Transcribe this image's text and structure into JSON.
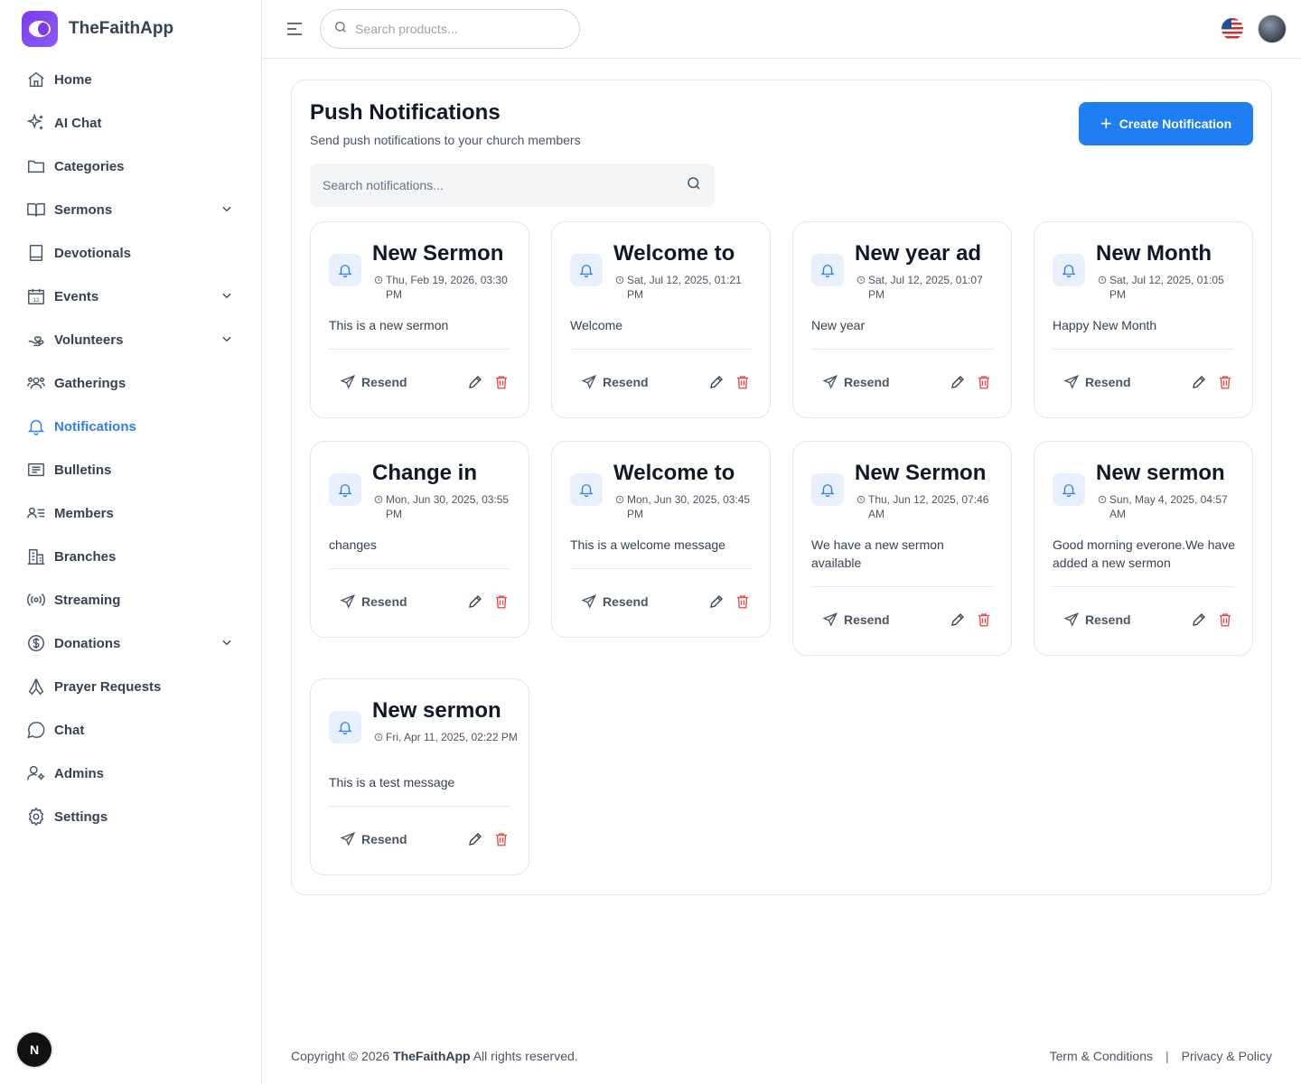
{
  "app": {
    "name": "TheFaithApp"
  },
  "sidebar": {
    "items": [
      {
        "label": "Home",
        "icon": "home-icon"
      },
      {
        "label": "AI Chat",
        "icon": "sparkles-icon"
      },
      {
        "label": "Categories",
        "icon": "folder-icon"
      },
      {
        "label": "Sermons",
        "icon": "book-open-icon",
        "expandable": true
      },
      {
        "label": "Devotionals",
        "icon": "book-icon"
      },
      {
        "label": "Events",
        "icon": "calendar-icon",
        "expandable": true
      },
      {
        "label": "Volunteers",
        "icon": "hand-heart-icon",
        "expandable": true
      },
      {
        "label": "Gatherings",
        "icon": "users-icon"
      },
      {
        "label": "Notifications",
        "icon": "bell-icon",
        "active": true
      },
      {
        "label": "Bulletins",
        "icon": "newspaper-icon"
      },
      {
        "label": "Members",
        "icon": "user-list-icon"
      },
      {
        "label": "Branches",
        "icon": "building-icon"
      },
      {
        "label": "Streaming",
        "icon": "broadcast-icon"
      },
      {
        "label": "Donations",
        "icon": "dollar-circle-icon",
        "expandable": true
      },
      {
        "label": "Prayer Requests",
        "icon": "praying-hands-icon"
      },
      {
        "label": "Chat",
        "icon": "chat-bubble-icon"
      },
      {
        "label": "Admins",
        "icon": "user-cog-icon"
      },
      {
        "label": "Settings",
        "icon": "gear-icon"
      }
    ],
    "badge": "N"
  },
  "topbar": {
    "search_placeholder": "Search products..."
  },
  "page": {
    "title": "Push Notifications",
    "subtitle": "Send push notifications to your church members",
    "create_label": "Create Notification",
    "search_placeholder": "Search notifications..."
  },
  "notifications": [
    {
      "title": "New Sermon",
      "date": "Thu, Feb 19, 2026, 03:30 PM",
      "message": "This is a new sermon"
    },
    {
      "title": "Welcome to",
      "date": "Sat, Jul 12, 2025, 01:21 PM",
      "message": "Welcome"
    },
    {
      "title": "New year ad",
      "date": "Sat, Jul 12, 2025, 01:07 PM",
      "message": "New year"
    },
    {
      "title": "New Month",
      "date": "Sat, Jul 12, 2025, 01:05 PM",
      "message": "Happy New Month"
    },
    {
      "title": "Change in",
      "date": "Mon, Jun 30, 2025, 03:55 PM",
      "message": "changes"
    },
    {
      "title": "Welcome to",
      "date": "Mon, Jun 30, 2025, 03:45 PM",
      "message": "This is a welcome message"
    },
    {
      "title": "New Sermon",
      "date": "Thu, Jun 12, 2025, 07:46 AM",
      "message": "We have a new sermon available"
    },
    {
      "title": "New sermon",
      "date": "Sun, May 4, 2025, 04:57 AM",
      "message": "Good morning everone.We have added a new sermon"
    },
    {
      "title": "New sermon",
      "date": "Fri, Apr 11, 2025, 02:22 PM",
      "message": "This is a test message"
    }
  ],
  "card_actions": {
    "resend_label": "Resend"
  },
  "footer": {
    "copyright_prefix": "Copyright © 2026",
    "brand": "TheFaithApp",
    "copyright_suffix": "All rights reserved.",
    "terms": "Term & Conditions",
    "separator": "|",
    "privacy": "Privacy & Policy"
  },
  "colors": {
    "accent": "#1f7ef1",
    "active_nav": "#2f80ed",
    "danger": "#ef4444",
    "logo": "#7c3aed"
  }
}
